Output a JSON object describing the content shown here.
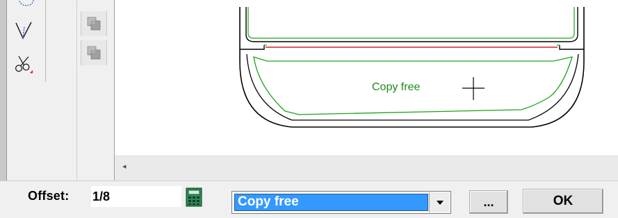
{
  "canvas": {
    "copy_label": "Copy free"
  },
  "scrollbar": {
    "left_arrow": "◂"
  },
  "bottom": {
    "offset_label": "Offset:",
    "offset_value": "1/8",
    "mode_selected": "Copy free",
    "more_label": "...",
    "ok_label": "OK"
  },
  "colors": {
    "outline": "#000000",
    "copy_line": "#1aa31a",
    "divider_line": "#d42020",
    "selection": "#3399ff"
  },
  "icons": [
    "circle-tool-icon",
    "dart-tool-icon",
    "scissors-tool-icon",
    "grid-copy-icon",
    "grid-move-icon",
    "calculator-icon",
    "crosshair-cursor-icon",
    "dropdown-arrow-icon"
  ]
}
